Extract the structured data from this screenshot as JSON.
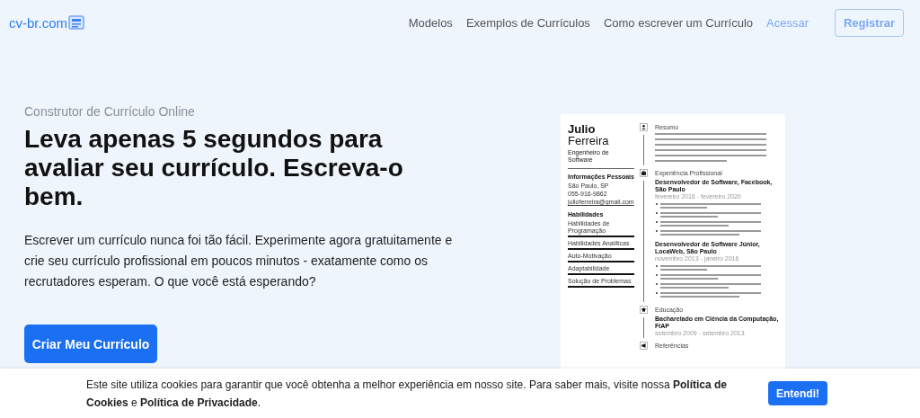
{
  "header": {
    "logo": "cv-br.com",
    "nav": [
      {
        "label": "Modelos",
        "kind": "link"
      },
      {
        "label": "Exemplos de Currículos",
        "kind": "link"
      },
      {
        "label": "Como escrever um Currículo",
        "kind": "link"
      },
      {
        "label": "Acessar",
        "kind": "accent"
      },
      {
        "label": "Registrar",
        "kind": "button"
      }
    ]
  },
  "hero": {
    "eyebrow": "Construtor de Currículo Online",
    "title": "Leva apenas 5 segundos para avaliar seu currículo. Escreva-o bem.",
    "body": "Escrever um currículo nunca foi tão fácil. Experimente agora gratuitamente e crie seu currículo profissional em poucos minutos - exatamente como os recrutadores esperam. O que você está esperando?",
    "cta": "Criar Meu Currículo"
  },
  "resume": {
    "first_name": "Julio",
    "last_name": "Ferreira",
    "role": "Engenheiro de Software",
    "personal": {
      "heading": "Informações Pessoais",
      "lines": [
        "São Paulo, SP",
        "055-916-9862",
        "julioferreira@gmail.com"
      ]
    },
    "skills": {
      "heading": "Habilidades",
      "items": [
        "Habilidades de Programação",
        "Habilidades Analíticas",
        "Auto-Motivação",
        "Adaptabilidade",
        "Solução de Problemas"
      ]
    },
    "sections": [
      {
        "kind": "summary",
        "title": "Resumo"
      },
      {
        "kind": "experience",
        "title": "Experiência Profissional",
        "jobs": [
          {
            "title": "Desenvolvedor de Software, Facebook, São Paulo",
            "dates": "fevereiro 2016 - fevereiro 2020"
          },
          {
            "title": "Desenvolvedor de Software Júnior, LocaWeb, São Paulo",
            "dates": "novembro 2013 - janeiro 2016"
          }
        ]
      },
      {
        "kind": "education",
        "title": "Educação",
        "degree": "Bacharelado em Ciência da Computação, FIAP",
        "dates": "setembro 2009 - setembro 2013"
      },
      {
        "kind": "references",
        "title": "Referências"
      }
    ]
  },
  "cookie": {
    "text": "Este site utiliza cookies para garantir que você obtenha a melhor experiência em nosso site. Para saber mais, visite nossa **Política de Cookies** e **Política de Privacidade**.",
    "button": "Entendi!"
  }
}
